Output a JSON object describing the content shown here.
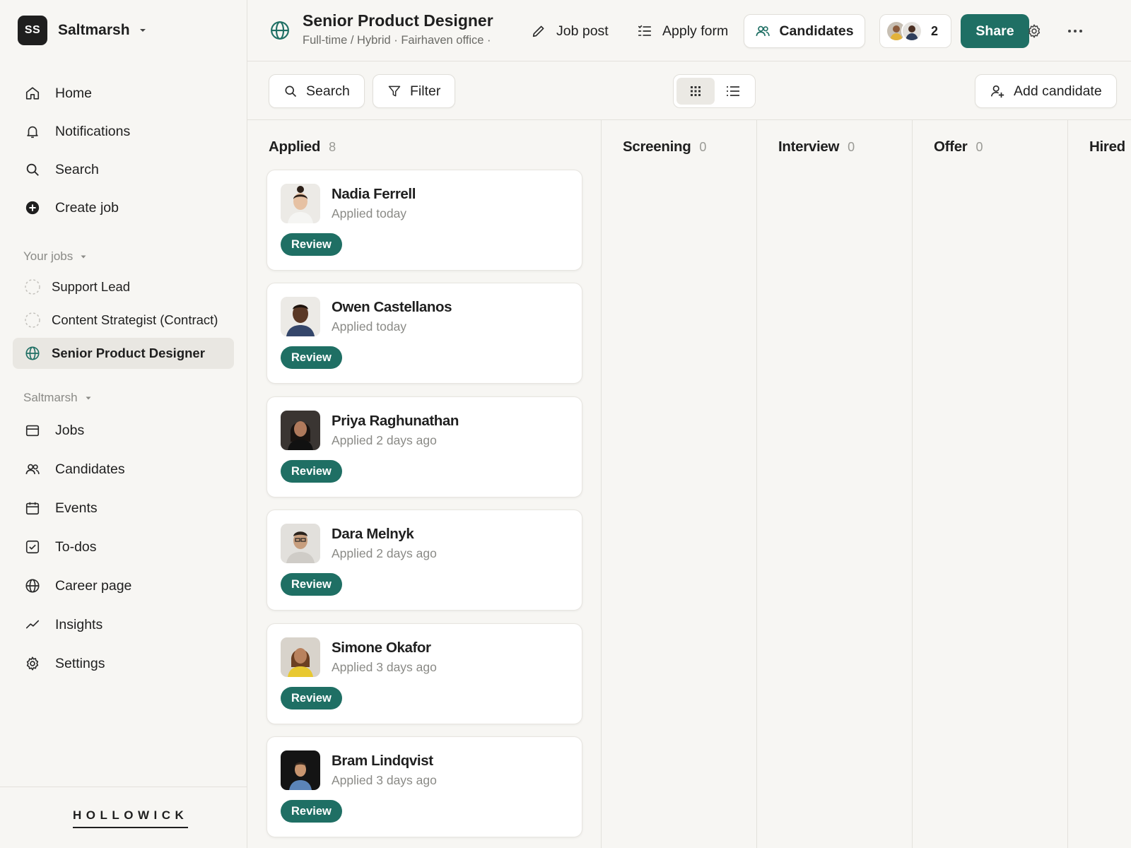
{
  "workspace": {
    "initials": "SS",
    "name": "Saltmarsh"
  },
  "nav": {
    "home": "Home",
    "notifications": "Notifications",
    "search": "Search",
    "create_job": "Create job"
  },
  "your_jobs": {
    "label": "Your jobs",
    "items": [
      {
        "label": "Support Lead"
      },
      {
        "label": "Content Strategist (Contract)"
      },
      {
        "label": "Senior Product Designer"
      }
    ]
  },
  "org_section": {
    "label": "Saltmarsh",
    "items": [
      {
        "label": "Jobs",
        "icon": "briefcase-icon"
      },
      {
        "label": "Candidates",
        "icon": "users-icon"
      },
      {
        "label": "Events",
        "icon": "calendar-icon"
      },
      {
        "label": "To-dos",
        "icon": "checkbox-icon"
      },
      {
        "label": "Career page",
        "icon": "globe-icon"
      },
      {
        "label": "Insights",
        "icon": "trend-icon"
      },
      {
        "label": "Settings",
        "icon": "gear-icon"
      }
    ]
  },
  "brand": "HOLLOWICK",
  "header": {
    "title": "Senior Product Designer",
    "subtitle": "Full-time / Hybrid · Fairhaven office ·",
    "job_post": "Job post",
    "apply_form": "Apply form",
    "candidates": "Candidates",
    "collaborator_count": "2",
    "share": "Share"
  },
  "toolbar": {
    "search": "Search",
    "filter": "Filter",
    "add_candidate": "Add candidate"
  },
  "board": {
    "columns": [
      {
        "title": "Applied",
        "count": "8"
      },
      {
        "title": "Screening",
        "count": "0"
      },
      {
        "title": "Interview",
        "count": "0"
      },
      {
        "title": "Offer",
        "count": "0"
      },
      {
        "title": "Hired",
        "count": ""
      }
    ],
    "cards": [
      {
        "name": "Nadia Ferrell",
        "applied": "Applied today",
        "action": "Review"
      },
      {
        "name": "Owen Castellanos",
        "applied": "Applied today",
        "action": "Review"
      },
      {
        "name": "Priya Raghunathan",
        "applied": "Applied 2 days ago",
        "action": "Review"
      },
      {
        "name": "Dara Melnyk",
        "applied": "Applied 2 days ago",
        "action": "Review"
      },
      {
        "name": "Simone Okafor",
        "applied": "Applied 3 days ago",
        "action": "Review"
      },
      {
        "name": "Bram Lindqvist",
        "applied": "Applied 3 days ago",
        "action": "Review"
      }
    ]
  },
  "colors": {
    "accent": "#1f6f64",
    "background": "#f7f6f3",
    "active_item": "#e9e7e2"
  }
}
